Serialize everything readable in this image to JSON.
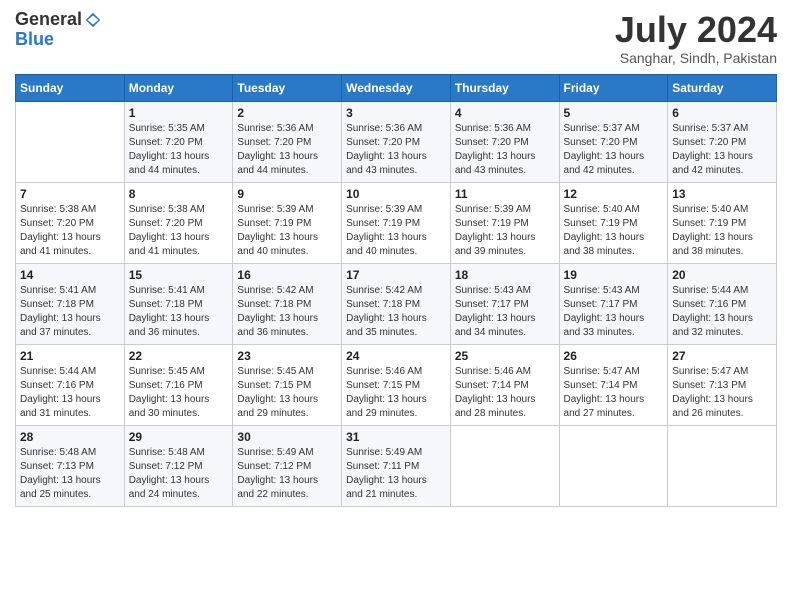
{
  "header": {
    "logo_general": "General",
    "logo_blue": "Blue",
    "month_title": "July 2024",
    "location": "Sanghar, Sindh, Pakistan"
  },
  "calendar": {
    "days_of_week": [
      "Sunday",
      "Monday",
      "Tuesday",
      "Wednesday",
      "Thursday",
      "Friday",
      "Saturday"
    ],
    "weeks": [
      [
        {
          "day": "",
          "info": ""
        },
        {
          "day": "1",
          "info": "Sunrise: 5:35 AM\nSunset: 7:20 PM\nDaylight: 13 hours and 44 minutes."
        },
        {
          "day": "2",
          "info": "Sunrise: 5:36 AM\nSunset: 7:20 PM\nDaylight: 13 hours and 44 minutes."
        },
        {
          "day": "3",
          "info": "Sunrise: 5:36 AM\nSunset: 7:20 PM\nDaylight: 13 hours and 43 minutes."
        },
        {
          "day": "4",
          "info": "Sunrise: 5:36 AM\nSunset: 7:20 PM\nDaylight: 13 hours and 43 minutes."
        },
        {
          "day": "5",
          "info": "Sunrise: 5:37 AM\nSunset: 7:20 PM\nDaylight: 13 hours and 42 minutes."
        },
        {
          "day": "6",
          "info": "Sunrise: 5:37 AM\nSunset: 7:20 PM\nDaylight: 13 hours and 42 minutes."
        }
      ],
      [
        {
          "day": "7",
          "info": "Sunrise: 5:38 AM\nSunset: 7:20 PM\nDaylight: 13 hours and 41 minutes."
        },
        {
          "day": "8",
          "info": "Sunrise: 5:38 AM\nSunset: 7:20 PM\nDaylight: 13 hours and 41 minutes."
        },
        {
          "day": "9",
          "info": "Sunrise: 5:39 AM\nSunset: 7:19 PM\nDaylight: 13 hours and 40 minutes."
        },
        {
          "day": "10",
          "info": "Sunrise: 5:39 AM\nSunset: 7:19 PM\nDaylight: 13 hours and 40 minutes."
        },
        {
          "day": "11",
          "info": "Sunrise: 5:39 AM\nSunset: 7:19 PM\nDaylight: 13 hours and 39 minutes."
        },
        {
          "day": "12",
          "info": "Sunrise: 5:40 AM\nSunset: 7:19 PM\nDaylight: 13 hours and 38 minutes."
        },
        {
          "day": "13",
          "info": "Sunrise: 5:40 AM\nSunset: 7:19 PM\nDaylight: 13 hours and 38 minutes."
        }
      ],
      [
        {
          "day": "14",
          "info": "Sunrise: 5:41 AM\nSunset: 7:18 PM\nDaylight: 13 hours and 37 minutes."
        },
        {
          "day": "15",
          "info": "Sunrise: 5:41 AM\nSunset: 7:18 PM\nDaylight: 13 hours and 36 minutes."
        },
        {
          "day": "16",
          "info": "Sunrise: 5:42 AM\nSunset: 7:18 PM\nDaylight: 13 hours and 36 minutes."
        },
        {
          "day": "17",
          "info": "Sunrise: 5:42 AM\nSunset: 7:18 PM\nDaylight: 13 hours and 35 minutes."
        },
        {
          "day": "18",
          "info": "Sunrise: 5:43 AM\nSunset: 7:17 PM\nDaylight: 13 hours and 34 minutes."
        },
        {
          "day": "19",
          "info": "Sunrise: 5:43 AM\nSunset: 7:17 PM\nDaylight: 13 hours and 33 minutes."
        },
        {
          "day": "20",
          "info": "Sunrise: 5:44 AM\nSunset: 7:16 PM\nDaylight: 13 hours and 32 minutes."
        }
      ],
      [
        {
          "day": "21",
          "info": "Sunrise: 5:44 AM\nSunset: 7:16 PM\nDaylight: 13 hours and 31 minutes."
        },
        {
          "day": "22",
          "info": "Sunrise: 5:45 AM\nSunset: 7:16 PM\nDaylight: 13 hours and 30 minutes."
        },
        {
          "day": "23",
          "info": "Sunrise: 5:45 AM\nSunset: 7:15 PM\nDaylight: 13 hours and 29 minutes."
        },
        {
          "day": "24",
          "info": "Sunrise: 5:46 AM\nSunset: 7:15 PM\nDaylight: 13 hours and 29 minutes."
        },
        {
          "day": "25",
          "info": "Sunrise: 5:46 AM\nSunset: 7:14 PM\nDaylight: 13 hours and 28 minutes."
        },
        {
          "day": "26",
          "info": "Sunrise: 5:47 AM\nSunset: 7:14 PM\nDaylight: 13 hours and 27 minutes."
        },
        {
          "day": "27",
          "info": "Sunrise: 5:47 AM\nSunset: 7:13 PM\nDaylight: 13 hours and 26 minutes."
        }
      ],
      [
        {
          "day": "28",
          "info": "Sunrise: 5:48 AM\nSunset: 7:13 PM\nDaylight: 13 hours and 25 minutes."
        },
        {
          "day": "29",
          "info": "Sunrise: 5:48 AM\nSunset: 7:12 PM\nDaylight: 13 hours and 24 minutes."
        },
        {
          "day": "30",
          "info": "Sunrise: 5:49 AM\nSunset: 7:12 PM\nDaylight: 13 hours and 22 minutes."
        },
        {
          "day": "31",
          "info": "Sunrise: 5:49 AM\nSunset: 7:11 PM\nDaylight: 13 hours and 21 minutes."
        },
        {
          "day": "",
          "info": ""
        },
        {
          "day": "",
          "info": ""
        },
        {
          "day": "",
          "info": ""
        }
      ]
    ]
  }
}
